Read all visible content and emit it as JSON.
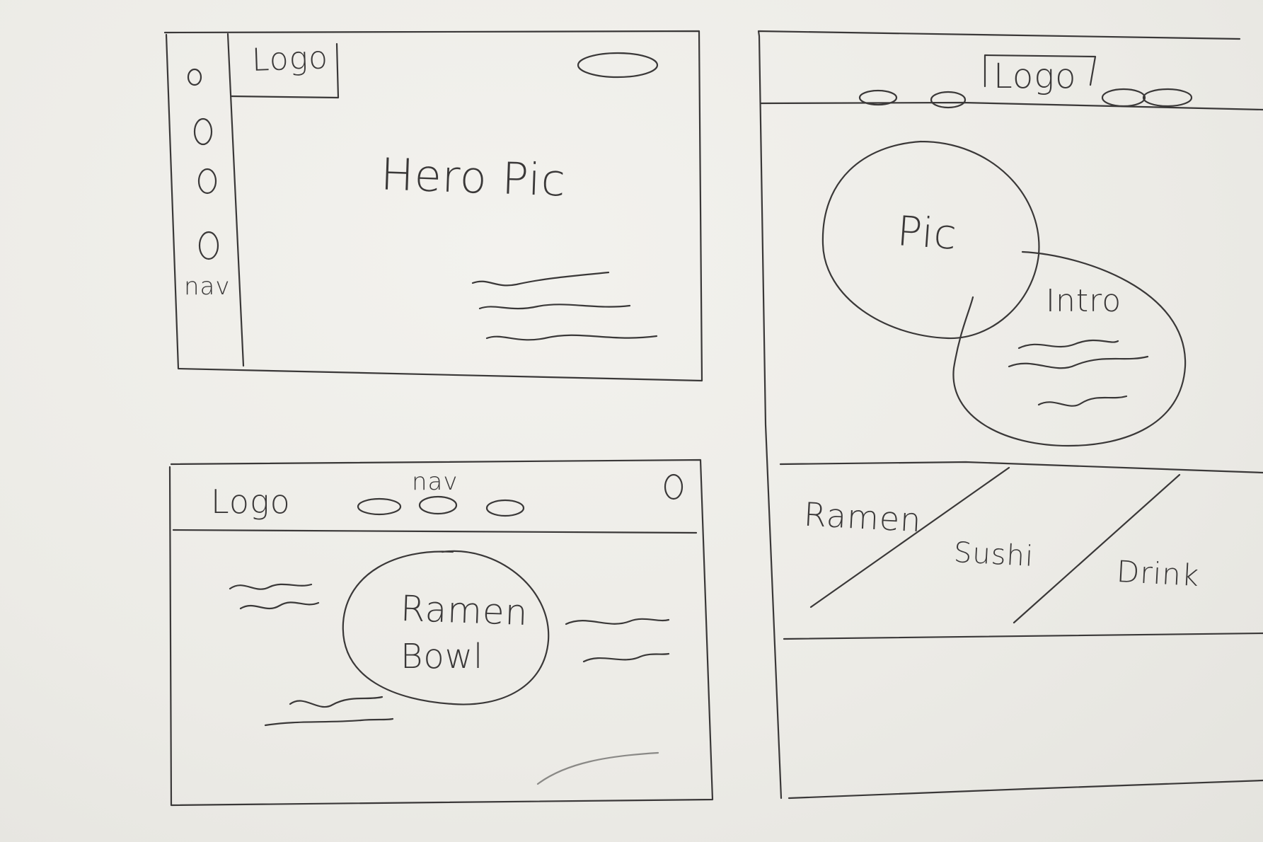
{
  "sketches": {
    "top_left": {
      "logo": "Logo",
      "hero": "Hero Pic",
      "nav": "nav"
    },
    "bottom_left": {
      "logo": "Logo",
      "nav": "nav",
      "center": "Ramen\nBowl",
      "center_line1": "Ramen",
      "center_line2": "Bowl"
    },
    "right": {
      "logo": "Logo",
      "pic": "Pic",
      "intro": "Intro",
      "categories": [
        "Ramen",
        "Sushi",
        "Drink"
      ]
    }
  },
  "colors": {
    "paper": "#ecebe6",
    "ink": "#3a3838"
  }
}
